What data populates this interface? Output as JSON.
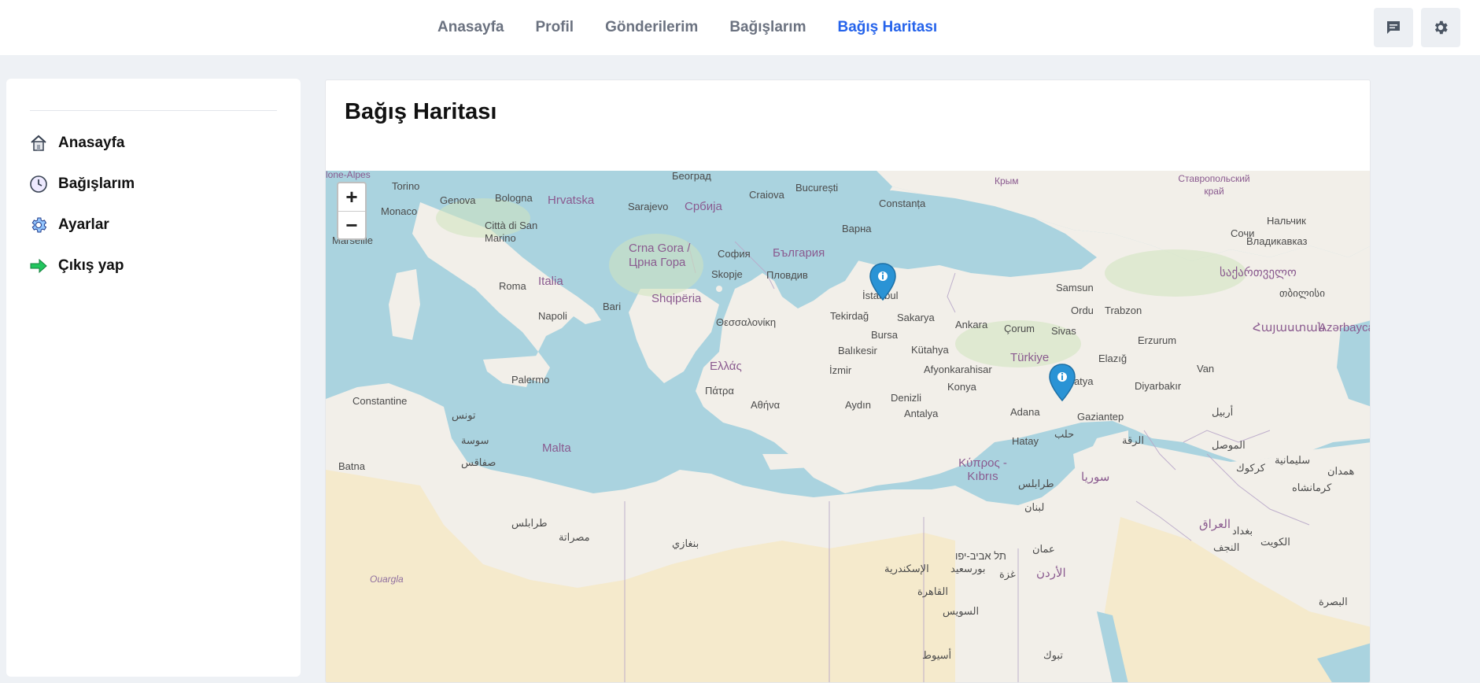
{
  "nav": {
    "items": [
      {
        "label": "Anasayfa"
      },
      {
        "label": "Profil"
      },
      {
        "label": "Gönderilerim"
      },
      {
        "label": "Bağışlarım"
      },
      {
        "label": "Bağış Haritası"
      }
    ],
    "active_index": 4
  },
  "topbar": {
    "message_icon": "chat-icon",
    "settings_icon": "gear-icon"
  },
  "sidebar": {
    "items": [
      {
        "label": "Anasayfa",
        "icon": "home-icon"
      },
      {
        "label": "Bağışlarım",
        "icon": "clock-icon"
      },
      {
        "label": "Ayarlar",
        "icon": "gear-icon"
      },
      {
        "label": "Çıkış yap",
        "icon": "arrow-right-icon"
      }
    ]
  },
  "main": {
    "title": "Bağış Haritası"
  },
  "map": {
    "zoom_in": "+",
    "zoom_out": "−",
    "labels": {
      "torino": "Torino",
      "genova": "Genova",
      "bologna": "Bologna",
      "hrvatska": "Hrvatska",
      "sarajevo": "Sarajevo",
      "srbija": "Србија",
      "beograd": "Београд",
      "craiova": "Craiova",
      "bucuresti": "București",
      "constanta": "Constanța",
      "monaco": "Monaco",
      "san_marino": "Città di San Marino",
      "marseille": "Marseille",
      "crna_gora": "Crna Gora / Црна Гора",
      "sofia": "София",
      "bulgaria": "България",
      "varna": "Варна",
      "skopje": "Skopje",
      "plovdiv": "Пловдив",
      "roma": "Roma",
      "italia": "Italia",
      "bari": "Bari",
      "shqiperia": "Shqipëria",
      "napoli": "Napoli",
      "thessaloniki": "Θεσσαλονίκη",
      "istanbul": "İstanbul",
      "tekirdag": "Tekirdağ",
      "sakarya": "Sakarya",
      "bursa": "Bursa",
      "ankara": "Ankara",
      "corum": "Çorum",
      "samsun": "Samsun",
      "ordu": "Ordu",
      "trabzon": "Trabzon",
      "sivas": "Sivas",
      "erzurum": "Erzurum",
      "balikesir": "Balıkesir",
      "kutahya": "Kütahya",
      "afyon": "Afyonkarahisar",
      "turkiye": "Türkiye",
      "elazig": "Elazığ",
      "van": "Van",
      "ellada": "Ελλάς",
      "izmir": "İzmir",
      "konya": "Konya",
      "malatya": "Malatya",
      "diyarbakir": "Diyarbakır",
      "palermo": "Palermo",
      "patra": "Πάτρα",
      "athina": "Αθήνα",
      "aydin": "Aydın",
      "denizli": "Denizli",
      "antalya": "Antalya",
      "adana": "Adana",
      "gaziantep": "Gaziantep",
      "hatay": "Hatay",
      "constantine": "Constantine",
      "malta": "Malta",
      "kypros": "Κύπρος - Kıbrıs",
      "batna": "Batna",
      "ouargla": "Ouargla",
      "sochi": "Сочи",
      "nalchik": "Нальчик",
      "vladikavkaz": "Владикавказ",
      "stavropol": "Ставропольский край",
      "krym": "Крым",
      "azerbaycan": "Azərbaycan",
      "sakartvelo": "საქართველო",
      "tbilisi": "თბილისი",
      "armenia": "Հայաստան",
      "alps": "lone-Alpes",
      "tunis": "تونس",
      "sousse": "سوسة",
      "sfax": "صفاقس",
      "tripoli": "طرابلس",
      "misrata": "مصراتة",
      "benghazi": "بنغازي",
      "alexandria": "الإسكندرية",
      "cairo": "القاهرة",
      "suez": "السويس",
      "tel_aviv": "תל אביב-יפו",
      "amman": "عمان",
      "jordan": "الأردن",
      "lebanon": "لبنان",
      "syria": "سوريا",
      "halab": "حلب",
      "mosul": "الموصل",
      "iraq": "العراق",
      "baghdad": "بغداد",
      "najaf": "النجف",
      "kuwait": "الكويت",
      "basra": "البصرة",
      "raqqa": "الرقة",
      "asyut": "أسيوط",
      "tabuk": "تبوك",
      "erbil": "أربيل",
      "kirkuk": "كركوك",
      "sulaymaniyah": "سليمانية",
      "hamadan": "همدان",
      "kermanshah": "كرمانشاه",
      "tripoli_leb": "طرابلس",
      "port_said": "بورسعيد",
      "gaza": "غزة"
    }
  },
  "colors": {
    "accent": "#2563eb",
    "nav_text": "#6b7280",
    "sea": "#aad3df",
    "land": "#f2efe9",
    "marker": "#2a93d5"
  }
}
